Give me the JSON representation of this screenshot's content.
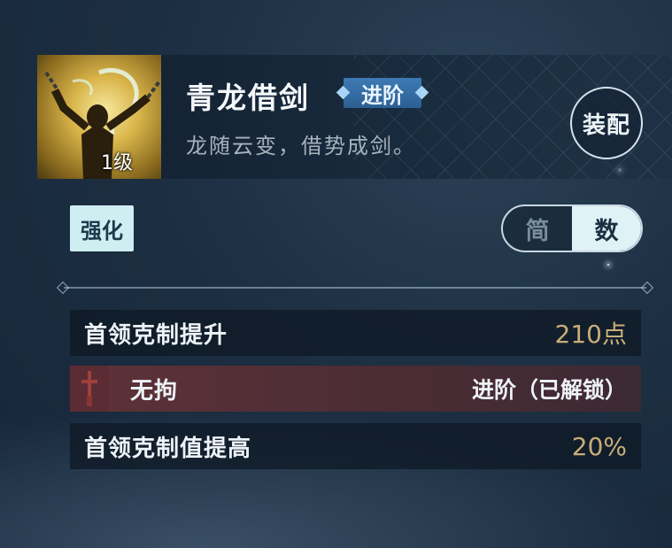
{
  "skill": {
    "name": "青龙借剑",
    "tier_badge": "进阶",
    "description": "龙随云变，借势成剑。",
    "level_text": "1级",
    "icon": "dragon-warrior-icon"
  },
  "buttons": {
    "equip": "装配",
    "enhance": "强化"
  },
  "view_toggle": {
    "simple": "简",
    "detail": "数",
    "selected": "数"
  },
  "stats": [
    {
      "label": "首领克制提升",
      "value": "210点"
    },
    {
      "label": "无拘",
      "value": "进阶（已解锁）",
      "icon": "sword-icon"
    },
    {
      "label": "首领克制值提高",
      "value": "20%"
    }
  ],
  "colors": {
    "accent_blue": "#2c5f93",
    "value_gold": "#c9ad78",
    "unlocked_row": "#5e3238",
    "toggle_active": "#dff2f6"
  }
}
